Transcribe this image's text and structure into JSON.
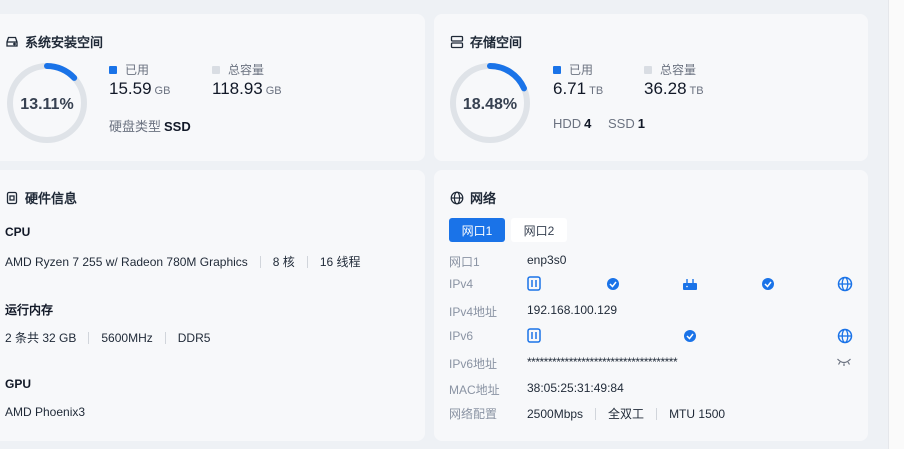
{
  "system_space": {
    "title": "系统安装空间",
    "percent_label": "13.11%",
    "percent": 13.11,
    "used_label": "已用",
    "used_value": "15.59",
    "used_unit": "GB",
    "total_label": "总容量",
    "total_value": "118.93",
    "total_unit": "GB",
    "disk_type_label": "硬盘类型",
    "disk_type_value": "SSD"
  },
  "storage_space": {
    "title": "存储空间",
    "percent_label": "18.48%",
    "percent": 18.48,
    "used_label": "已用",
    "used_value": "6.71",
    "used_unit": "TB",
    "total_label": "总容量",
    "total_value": "36.28",
    "total_unit": "TB",
    "hdd_label": "HDD",
    "hdd_value": "4",
    "ssd_label": "SSD",
    "ssd_value": "1"
  },
  "hardware": {
    "title": "硬件信息",
    "cpu_label": "CPU",
    "cpu_model": "AMD Ryzen 7 255 w/ Radeon 780M Graphics",
    "cpu_cores": "8 核",
    "cpu_threads": "16 线程",
    "mem_label": "运行内存",
    "mem_size": "2 条共 32 GB",
    "mem_speed": "5600MHz",
    "mem_type": "DDR5",
    "gpu_label": "GPU",
    "gpu_model": "AMD Phoenix3"
  },
  "network": {
    "title": "网络",
    "tabs": [
      {
        "label": "网口1",
        "active": true
      },
      {
        "label": "网口2",
        "active": false
      }
    ],
    "port_key": "网口1",
    "port_value": "enp3s0",
    "ipv4_key": "IPv4",
    "ipv4_addr_key": "IPv4地址",
    "ipv4_addr_value": "192.168.100.129",
    "ipv6_key": "IPv6",
    "ipv6_addr_key": "IPv6地址",
    "ipv6_addr_value": "************************************",
    "mac_key": "MAC地址",
    "mac_value": "38:05:25:31:49:84",
    "config_key": "网络配置",
    "config_speed": "2500Mbps",
    "config_duplex": "全双工",
    "config_mtu": "MTU 1500"
  },
  "colors": {
    "accent": "#1a73e8",
    "ring_track": "#dfe3e8",
    "total_square": "#d9dde3"
  }
}
